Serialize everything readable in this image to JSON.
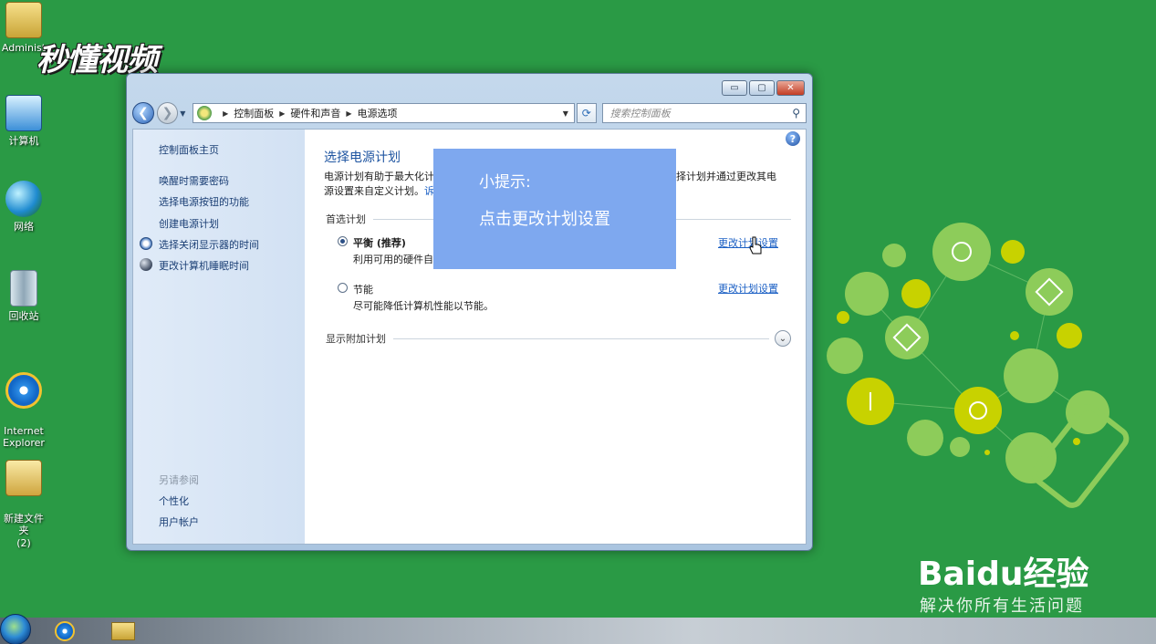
{
  "desktop": {
    "icons": [
      {
        "label": "Administ"
      },
      {
        "label": "计算机"
      },
      {
        "label": "网络"
      },
      {
        "label": "回收站"
      },
      {
        "label": "Internet\nExplorer"
      },
      {
        "label": "新建文件夹\n(2)"
      }
    ]
  },
  "watermark": {
    "logo": "秒懂视频"
  },
  "window": {
    "controls": {
      "minimize": "▭",
      "maximize": "▢",
      "close": "✕"
    },
    "nav": {
      "back": "❮",
      "forward": "❯",
      "dropdown": "▼"
    },
    "breadcrumb": [
      "控制面板",
      "硬件和声音",
      "电源选项"
    ],
    "search_placeholder": "搜索控制面板",
    "sidebar": {
      "home": "控制面板主页",
      "links": [
        "唤醒时需要密码",
        "选择电源按钮的功能",
        "创建电源计划",
        "选择关闭显示器的时间",
        "更改计算机睡眠时间"
      ],
      "see_also_label": "另请参阅",
      "see_also": [
        "个性化",
        "用户帐户"
      ]
    },
    "main": {
      "title": "选择电源计划",
      "desc_line1_a": "电源计划有助于最大化计",
      "desc_line1_b": "选择计划并通过更改其电",
      "desc_line2_a": "源设置来自定义计划。",
      "desc_line2_link": "诉",
      "preferred_label": "首选计划",
      "plans": [
        {
          "name": "平衡 (推荐)",
          "desc": "利用可用的硬件自",
          "selected": true,
          "link": "更改计划设置"
        },
        {
          "name": "节能",
          "desc": "尽可能降低计算机性能以节能。",
          "selected": false,
          "link": "更改计划设置"
        }
      ],
      "additional_label": "显示附加计划"
    }
  },
  "tip": {
    "title": "小提示:",
    "body": "点击更改计划设置"
  },
  "branding": {
    "baidu": "Baidu经验",
    "slogan": "解决你所有生活问题"
  },
  "colors": {
    "desktop_bg": "#2a9a45",
    "tip_bg": "#7ea8ef",
    "link": "#1a5fc4"
  }
}
